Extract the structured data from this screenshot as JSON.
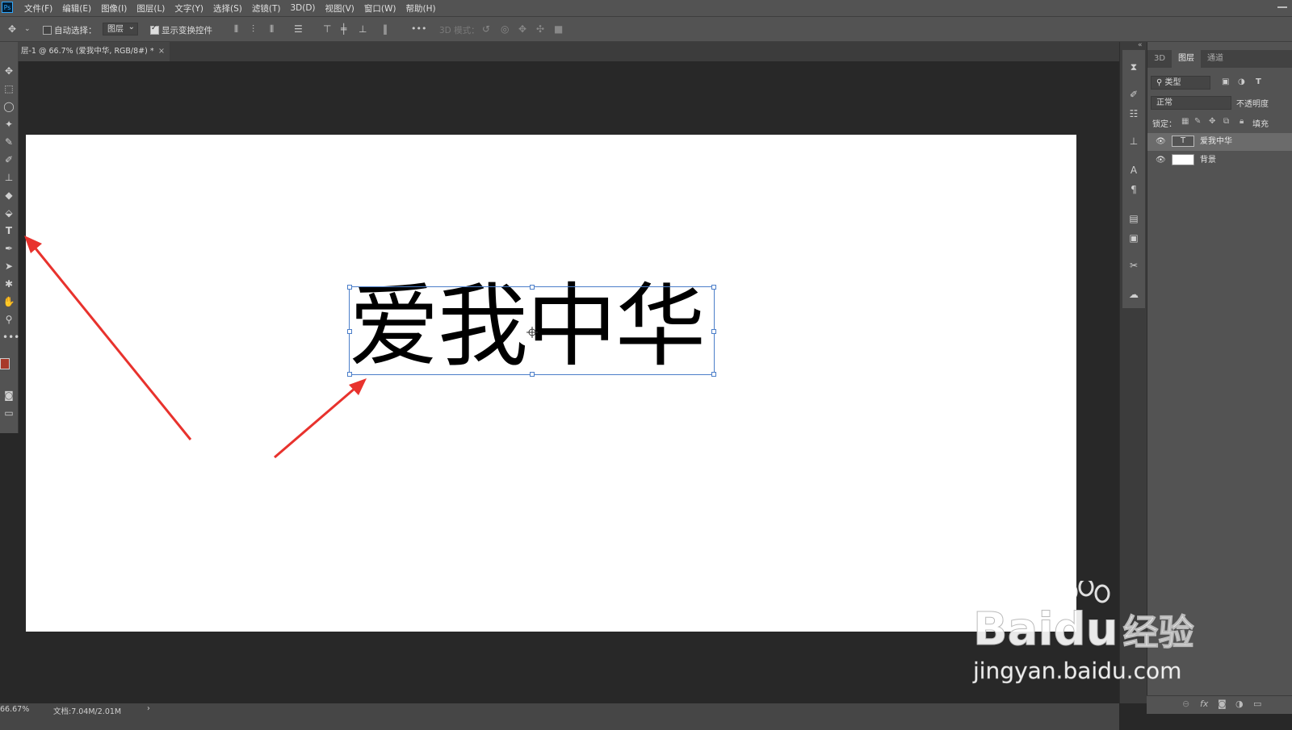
{
  "app": {
    "logo": "Ps"
  },
  "menu": [
    "文件(F)",
    "编辑(E)",
    "图像(I)",
    "图层(L)",
    "文字(Y)",
    "选择(S)",
    "滤镜(T)",
    "3D(D)",
    "视图(V)",
    "窗口(W)",
    "帮助(H)"
  ],
  "options": {
    "auto_select_label": "自动选择：",
    "auto_select_checked": false,
    "auto_select_value": "图层",
    "show_transform_label": "显示变换控件",
    "show_transform_checked": true,
    "more": "•••",
    "mode_3d_label": "3D 模式："
  },
  "document": {
    "tab_title": "层-1 @ 66.7% (爱我中华, RGB/8#) *",
    "close": "×",
    "text_content": "爱我中华"
  },
  "colors": {
    "foreground": "#a83a2a",
    "background": "#ffffff",
    "annotation_arrow": "#e8322d",
    "selection": "#4b7ec9"
  },
  "layers_panel": {
    "tabs": [
      "3D",
      "图层",
      "通道"
    ],
    "active_tab": "图层",
    "filter_label": "类型",
    "blend_mode": "正常",
    "opacity_label": "不透明度",
    "lock_label": "锁定：",
    "fill_label": "填充",
    "layers": [
      {
        "name": "爱我中华",
        "type": "text",
        "thumb_label": "T",
        "visible": true,
        "selected": true
      },
      {
        "name": "背景",
        "type": "raster",
        "visible": true,
        "selected": false
      }
    ],
    "bottom_fx": "fx"
  },
  "status": {
    "zoom": "66.67%",
    "doc_size": "文档:7.04M/2.01M",
    "arrow": "›"
  },
  "watermark": {
    "brand": "Bai",
    "brand_tail": "du",
    "site_cn": "经验",
    "url": "jingyan.baidu.com"
  }
}
